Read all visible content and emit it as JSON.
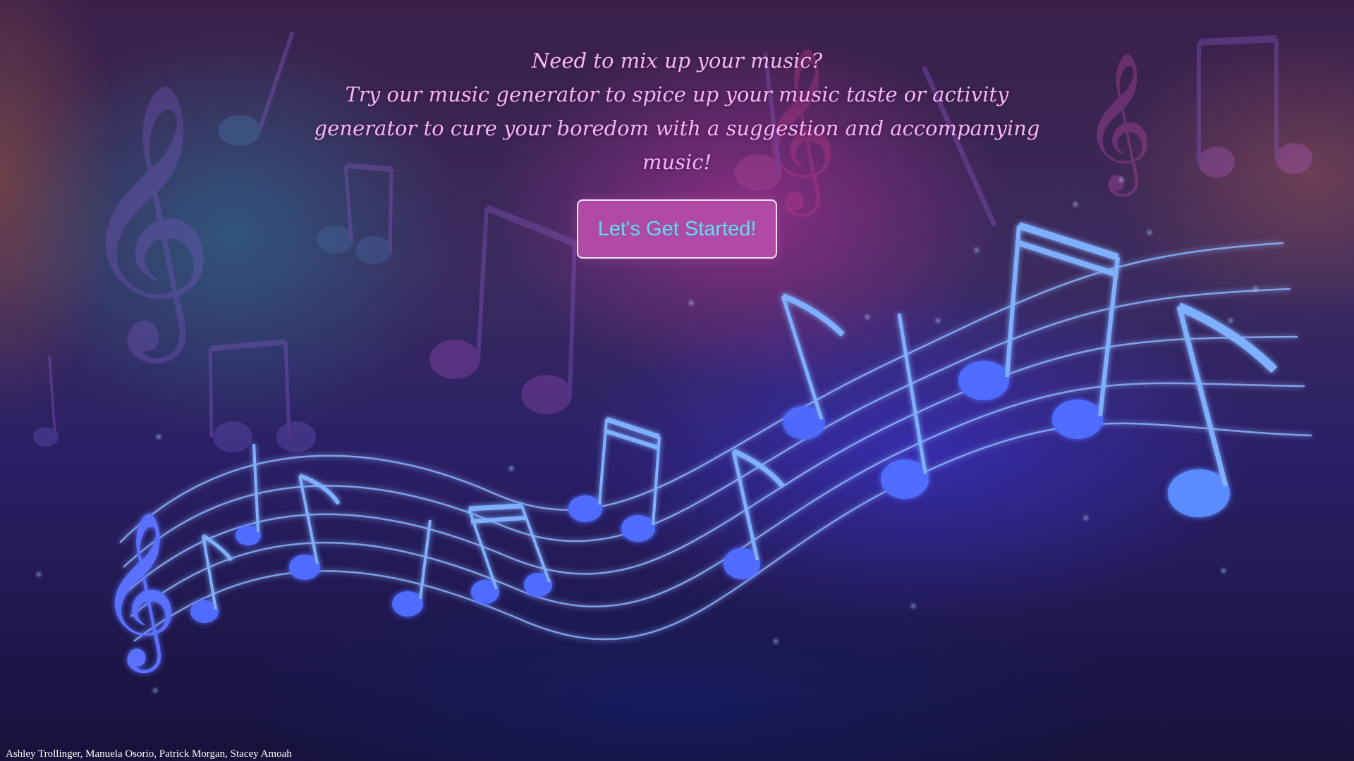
{
  "hero": {
    "line1": "Need to mix up your music?",
    "line2": "Try our music generator to spice up your music taste or activity generator to cure your boredom with a suggestion and accompanying music!"
  },
  "cta": {
    "label": "Let's Get Started!"
  },
  "footer": {
    "credits": "Ashley Trollinger, Manuela Osorio, Patrick Morgan, Stacey Amoah"
  },
  "background": {
    "image": "music-staff-notes-background",
    "colors": {
      "top": "#3a1f4a",
      "glow_pink": "#c832a0",
      "glow_teal": "#287896",
      "glow_blue": "#463cff",
      "bottom": "#16123a"
    }
  },
  "colors": {
    "heading_text": "#f3b8f4",
    "button_bg": "#b04aa6",
    "button_text": "#58e0f4",
    "button_border": "#f1e2f4",
    "credits_text": "#ffffff"
  }
}
